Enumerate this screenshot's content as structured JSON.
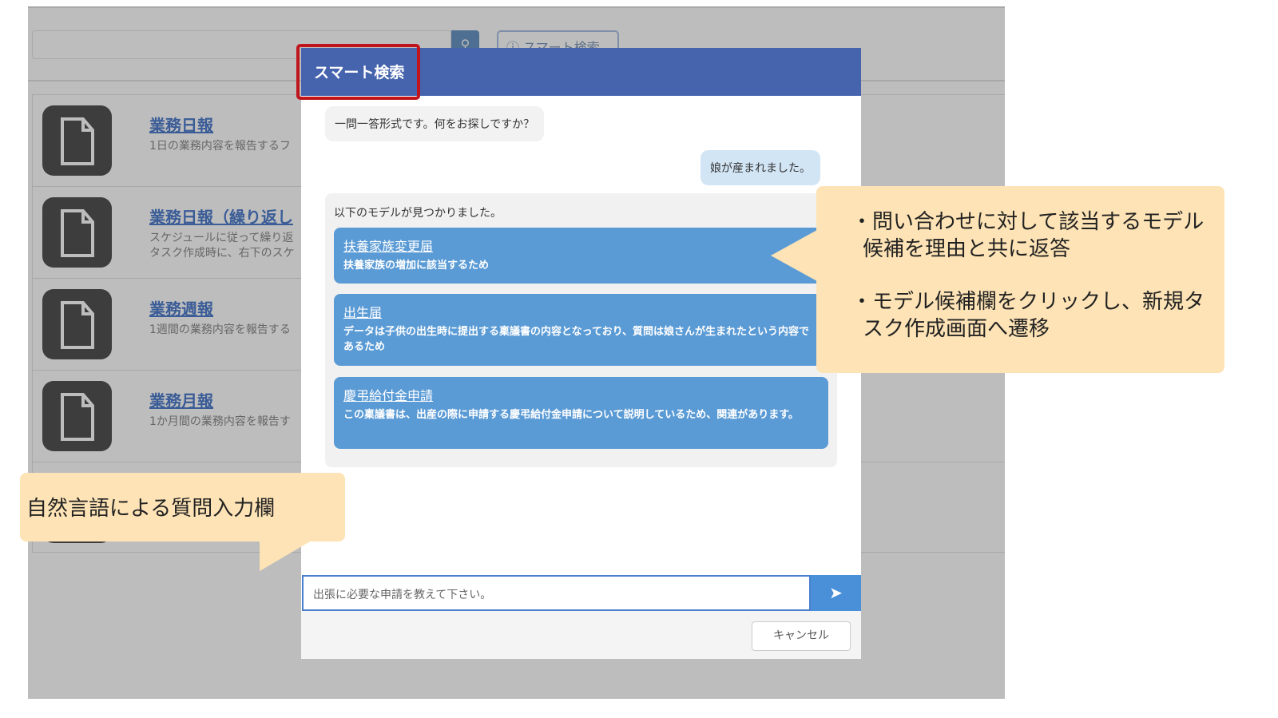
{
  "background_app": {
    "search_icon": "search-icon",
    "smart_search_label": "スマート検索",
    "rows": [
      {
        "title": "業務日報",
        "desc": [
          "1日の業務内容を報告するフ"
        ]
      },
      {
        "title": "業務日報（繰り返し",
        "desc": [
          "スケジュールに従って繰り返",
          "タスク作成時に、右下のスケ"
        ]
      },
      {
        "title": "業務週報",
        "desc": [
          "1週間の業務内容を報告する"
        ]
      },
      {
        "title": "業務月報",
        "desc": [
          "1か月間の業務内容を報告す"
        ]
      }
    ]
  },
  "modal": {
    "title": "スマート検索",
    "bot_message": "一問一答形式です。何をお探しですか？",
    "user_message": "娘が産まれました。",
    "results_header": "以下のモデルが見つかりました。",
    "results": [
      {
        "title": "扶養家族変更届",
        "reason": "扶養家族の増加に該当するため"
      },
      {
        "title": "出生届",
        "reason": "データは子供の出生時に提出する稟議書の内容となっており、質問は娘さんが生まれたという内容であるため"
      },
      {
        "title": "慶弔給付金申請",
        "reason": "この稟議書は、出産の際に申請する慶弔給付金申請について説明しているため、関連があります。"
      }
    ],
    "input_placeholder": "出張に必要な申請を教えて下さい。",
    "send_icon": "paper-plane-icon",
    "cancel_label": "キャンセル"
  },
  "annotations": {
    "right": [
      "・問い合わせに対して該当するモデル候補を理由と共に返答",
      "・モデル候補欄をクリックし、新規タスク作成画面へ遷移"
    ],
    "left": "自然言語による質問入力欄"
  },
  "colors": {
    "header": "#4664ae",
    "card": "#5b9bd5",
    "highlight": "#c0151c",
    "callout": "#fde3b5"
  }
}
